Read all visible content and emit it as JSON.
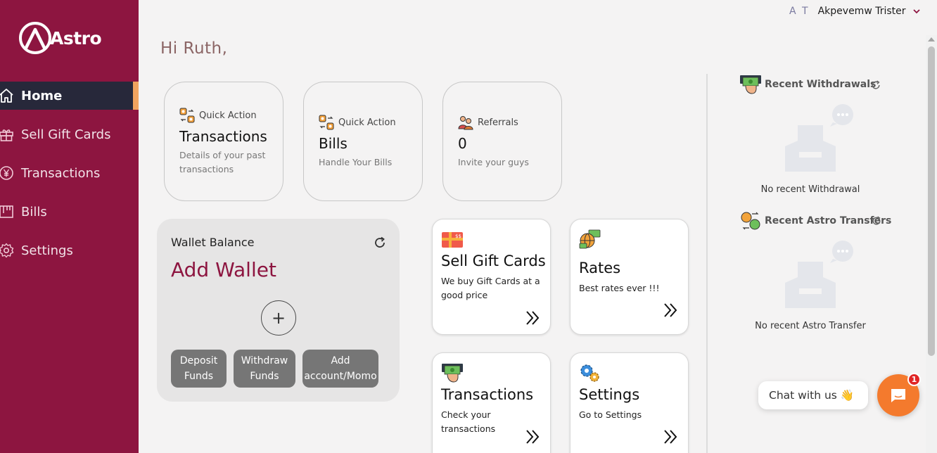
{
  "brand": {
    "name": "Astro"
  },
  "sidebar": {
    "items": [
      {
        "label": "Home",
        "icon": "home-icon",
        "active": true
      },
      {
        "label": "Sell Gift Cards",
        "icon": "gift-icon"
      },
      {
        "label": "Transactions",
        "icon": "yen-icon"
      },
      {
        "label": "Bills",
        "icon": "bills-icon"
      },
      {
        "label": "Settings",
        "icon": "gear-icon"
      }
    ]
  },
  "header": {
    "initials": "A T",
    "username": "Akpevemw Trister",
    "greeting": "Hi Ruth,"
  },
  "quick_cards": [
    {
      "label": "Quick Action",
      "title": "Transactions",
      "subtitle": "Details of your past transactions",
      "icon": "exchange-icon"
    },
    {
      "label": "Quick Action",
      "title": "Bills",
      "subtitle": "Handle Your Bills",
      "icon": "exchange-icon"
    },
    {
      "label": "Referrals",
      "title": "0",
      "subtitle": "Invite your guys",
      "icon": "people-icon"
    }
  ],
  "wallet": {
    "label": "Wallet Balance",
    "value": "Add Wallet",
    "plus": "+",
    "buttons": [
      "Deposit Funds",
      "Withdraw Funds",
      "Add account/Momo"
    ]
  },
  "features": [
    {
      "title": "Sell Gift Cards",
      "subtitle": "We buy Gift Cards at a good price",
      "icon": "gift-card-icon"
    },
    {
      "title": "Rates",
      "subtitle": "Best rates ever !!!",
      "icon": "globe-money-icon"
    },
    {
      "title": "Transactions",
      "subtitle": "Check your transactions",
      "icon": "cash-hand-icon"
    },
    {
      "title": "Settings",
      "subtitle": "Go to Settings",
      "icon": "gears-icon"
    }
  ],
  "right_panel": {
    "withdrawals": {
      "title": "Recent Withdrawals",
      "empty": "No recent Withdrawal"
    },
    "transfers": {
      "title": "Recent Astro Transfers",
      "empty": "No recent Astro Transfer"
    }
  },
  "chat": {
    "label": "Chat with us 👋",
    "badge": "1"
  },
  "colors": {
    "sidebar": "#8d1540",
    "active_nav": "#27283a",
    "accent": "#f1a45f",
    "chat": "#f47a2d"
  }
}
